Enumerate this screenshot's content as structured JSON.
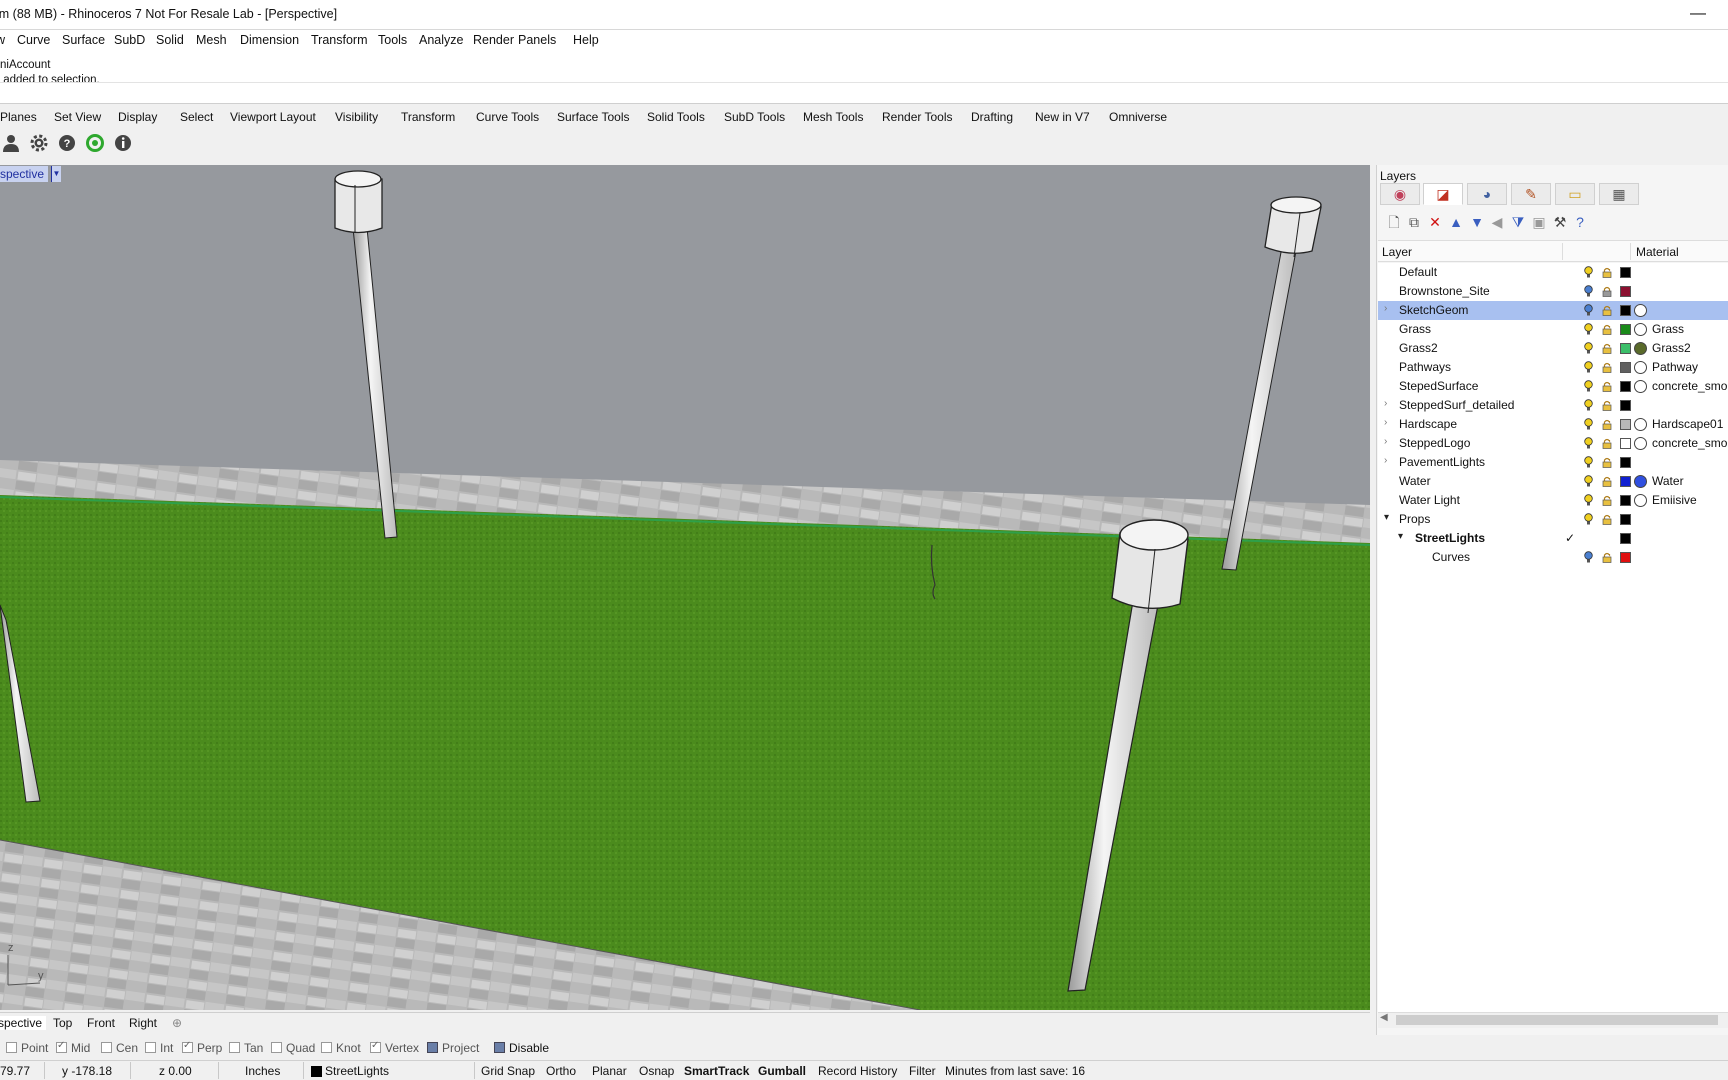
{
  "window": {
    "title": "lm (88 MB) - Rhinoceros 7 Not For Resale Lab - [Perspective]",
    "minimize_glyph": "—"
  },
  "menu": [
    "w",
    "Curve",
    "Surface",
    "SubD",
    "Solid",
    "Mesh",
    "Dimension",
    "Transform",
    "Tools",
    "Analyze",
    "Render",
    "Panels",
    "Help"
  ],
  "command_history": [
    "niAccount",
    " added to selection."
  ],
  "toolbar_tabs": [
    "Planes",
    "Set View",
    "Display",
    "Select",
    "Viewport Layout",
    "Visibility",
    "Transform",
    "Curve Tools",
    "Surface Tools",
    "Solid Tools",
    "SubD Tools",
    "Mesh Tools",
    "Render Tools",
    "Drafting",
    "New in V7",
    "Omniverse"
  ],
  "active_tab": "Omniverse",
  "toolbar_icons": [
    "user-icon",
    "settings-gear-icon",
    "help-icon",
    "omniverse-live-icon",
    "info-icon"
  ],
  "viewport": {
    "label": "spective",
    "tabs": [
      "spective",
      "Top",
      "Front",
      "Right"
    ],
    "add_tab_glyph": "⊕",
    "axis_z": "z",
    "axis_y": "y"
  },
  "osnaps": [
    {
      "label": "Point",
      "checked": false
    },
    {
      "label": "Mid",
      "checked": true
    },
    {
      "label": "Cen",
      "checked": false
    },
    {
      "label": "Int",
      "checked": false
    },
    {
      "label": "Perp",
      "checked": true
    },
    {
      "label": "Tan",
      "checked": false
    },
    {
      "label": "Quad",
      "checked": false
    },
    {
      "label": "Knot",
      "checked": false
    },
    {
      "label": "Vertex",
      "checked": true
    },
    {
      "label": "Project",
      "checked": true
    },
    {
      "label": "Disable",
      "checked": true
    }
  ],
  "status": {
    "x": "79.77",
    "y": "y -178.18",
    "z": "z 0.00",
    "units": "Inches",
    "current_layer": "StreetLights",
    "current_layer_color": "#000000",
    "grid_snap": "Grid Snap",
    "ortho": "Ortho",
    "planar": "Planar",
    "osnap": "Osnap",
    "smarttrack": "SmartTrack",
    "gumball": "Gumball",
    "record_history": "Record History",
    "filter": "Filter",
    "save_info": "Minutes from last save: 16"
  },
  "layers_panel": {
    "title": "Layers",
    "tabs": [
      "properties-icon",
      "layers-icon",
      "render-icon",
      "display-icon",
      "libraries-icon",
      "named-views-icon"
    ],
    "header_layer": "Layer",
    "header_material": "Material",
    "current_check": "✓",
    "rows": [
      {
        "name": "Default",
        "color": "#000000",
        "material": "",
        "indent": 0,
        "expand": "",
        "has_mat": false,
        "selected": false,
        "bold": false
      },
      {
        "name": "Brownstone_Site",
        "color": "#8b1030",
        "material": "",
        "indent": 0,
        "expand": "",
        "has_mat": false,
        "selected": false,
        "bold": false
      },
      {
        "name": "SketchGeom",
        "color": "#000000",
        "material": "",
        "indent": 0,
        "expand": "›",
        "has_mat": true,
        "selected": true,
        "bold": false
      },
      {
        "name": "Grass",
        "color": "#1a8a1a",
        "material": "Grass",
        "indent": 0,
        "expand": "",
        "has_mat": true,
        "selected": false,
        "bold": false
      },
      {
        "name": "Grass2",
        "color": "#3cbf6a",
        "material": "Grass2",
        "indent": 0,
        "expand": "",
        "has_mat": true,
        "selected": false,
        "bold": false,
        "mat_color": "#5a6a2a"
      },
      {
        "name": "Pathways",
        "color": "#606060",
        "material": "Pathway",
        "indent": 0,
        "expand": "",
        "has_mat": true,
        "selected": false,
        "bold": false
      },
      {
        "name": "StepedSurface",
        "color": "#000000",
        "material": "concrete_smo",
        "indent": 0,
        "expand": "",
        "has_mat": true,
        "selected": false,
        "bold": false
      },
      {
        "name": "SteppedSurf_detailed",
        "color": "#000000",
        "material": "",
        "indent": 0,
        "expand": "›",
        "has_mat": false,
        "selected": false,
        "bold": false
      },
      {
        "name": "Hardscape",
        "color": "#b8b8b8",
        "material": "Hardscape01",
        "indent": 0,
        "expand": "›",
        "has_mat": true,
        "selected": false,
        "bold": false
      },
      {
        "name": "SteppedLogo",
        "color": "#ffffff",
        "material": "concrete_smo",
        "indent": 0,
        "expand": "›",
        "has_mat": true,
        "selected": false,
        "bold": false
      },
      {
        "name": "PavementLights",
        "color": "#000000",
        "material": "",
        "indent": 0,
        "expand": "›",
        "has_mat": false,
        "selected": false,
        "bold": false
      },
      {
        "name": "Water",
        "color": "#1020d0",
        "material": "Water",
        "indent": 0,
        "expand": "",
        "has_mat": true,
        "selected": false,
        "bold": false,
        "mat_color": "#3050e0"
      },
      {
        "name": "Water Light",
        "color": "#000000",
        "material": "Emiisive",
        "indent": 0,
        "expand": "",
        "has_mat": true,
        "selected": false,
        "bold": false
      },
      {
        "name": "Props",
        "color": "#000000",
        "material": "",
        "indent": 0,
        "expand": "⌄",
        "has_mat": false,
        "selected": false,
        "bold": false
      },
      {
        "name": "StreetLights",
        "color": "#000000",
        "material": "",
        "indent": 1,
        "expand": "⌄",
        "has_mat": false,
        "selected": false,
        "bold": true,
        "current": true
      },
      {
        "name": "Curves",
        "color": "#e01010",
        "material": "",
        "indent": 2,
        "expand": "",
        "has_mat": false,
        "selected": false,
        "bold": false
      }
    ]
  },
  "colors": {
    "sky": "#96999e",
    "grass": "#4a8a1c",
    "pavement": "#b4b4b4",
    "selection": "#a8c0f0",
    "viewport_label_bg": "#c8d2f0"
  }
}
